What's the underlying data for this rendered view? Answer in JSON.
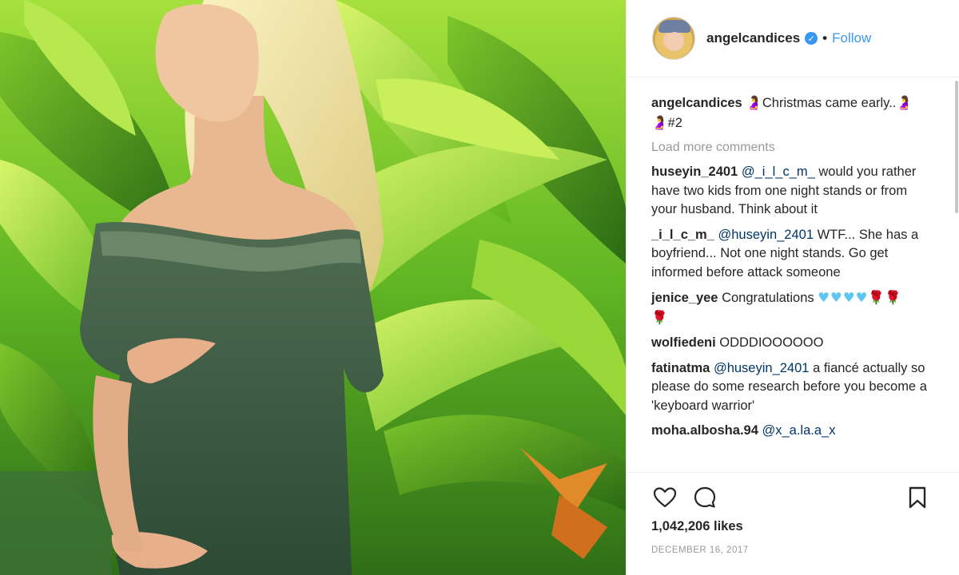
{
  "header": {
    "username": "angelcandices",
    "verified_mark": "✓",
    "separator": "•",
    "follow_label": "Follow"
  },
  "caption": {
    "username": "angelcandices",
    "emoji_before": "🤰",
    "text": "Christmas came early..",
    "emoji_after": "🤰",
    "emoji_line2": "🤰",
    "text_line2": "#2"
  },
  "load_more_label": "Load more comments",
  "comments": [
    {
      "username": "huseyin_2401",
      "mention": "@_i_l_c_m_",
      "text": "would you rather have two kids from one night stands or from your husband. Think about it"
    },
    {
      "username": "_i_l_c_m_",
      "mention": "@huseyin_2401",
      "text": "WTF... She has a boyfriend... Not one night stands. Go get informed before attack someone"
    },
    {
      "username": "jenice_yee",
      "mention": "",
      "text": "Congratulations",
      "hearts": "♥♥♥♥",
      "roses": "🌹🌹",
      "roses_line2": "🌹"
    },
    {
      "username": "wolfiedeni",
      "mention": "",
      "text": "ODDDIOOOOOO"
    },
    {
      "username": "fatinatma",
      "mention": "@huseyin_2401",
      "text": "a fiancé actually so please do some research before you become a 'keyboard warrior'"
    },
    {
      "username": "moha.albosha.94",
      "mention": "@x_a.la.a_x",
      "text": ""
    }
  ],
  "actions": {
    "like_icon": "heart-outline-icon",
    "comment_icon": "speech-bubble-icon",
    "save_icon": "bookmark-icon"
  },
  "likes_text": "1,042,206 likes",
  "date_text": "DECEMBER 16, 2017",
  "colors": {
    "link": "#3897f0",
    "mention": "#003569",
    "muted": "#999999",
    "text": "#262626",
    "border": "#efefef"
  }
}
